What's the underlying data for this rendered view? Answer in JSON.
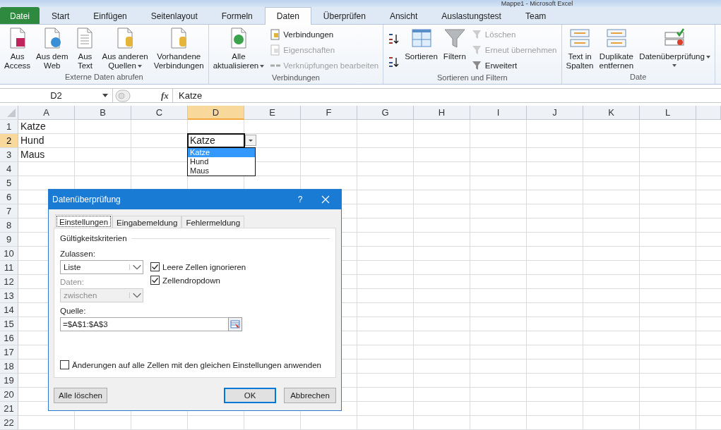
{
  "window": {
    "title": "Mappe1 - Microsoft Excel"
  },
  "tabs": [
    {
      "label": "Datei",
      "selected": false,
      "kind": "file"
    },
    {
      "label": "Start",
      "selected": false,
      "kind": "tab"
    },
    {
      "label": "Einfügen",
      "selected": false,
      "kind": "tab"
    },
    {
      "label": "Seitenlayout",
      "selected": false,
      "kind": "tab"
    },
    {
      "label": "Formeln",
      "selected": false,
      "kind": "tab"
    },
    {
      "label": "Daten",
      "selected": true,
      "kind": "tab"
    },
    {
      "label": "Überprüfen",
      "selected": false,
      "kind": "tab"
    },
    {
      "label": "Ansicht",
      "selected": false,
      "kind": "tab"
    },
    {
      "label": "Auslastungstest",
      "selected": false,
      "kind": "tab"
    },
    {
      "label": "Team",
      "selected": false,
      "kind": "tab"
    }
  ],
  "ribbon": {
    "groups": [
      {
        "label": "Externe Daten abrufen",
        "columns": [
          {
            "kind": "large",
            "items": [
              {
                "lines": [
                  "Aus",
                  "Access"
                ],
                "disabled": false,
                "dropdown": false
              }
            ]
          },
          {
            "kind": "large",
            "items": [
              {
                "lines": [
                  "Aus dem",
                  "Web"
                ],
                "disabled": false,
                "dropdown": false
              }
            ]
          },
          {
            "kind": "large",
            "items": [
              {
                "lines": [
                  "Aus",
                  "Text"
                ],
                "disabled": false,
                "dropdown": false
              }
            ]
          },
          {
            "kind": "large",
            "items": [
              {
                "lines": [
                  "Aus anderen",
                  "Quellen"
                ],
                "disabled": false,
                "dropdown": true
              }
            ]
          },
          {
            "kind": "large",
            "items": [
              {
                "lines": [
                  "Vorhandene",
                  "Verbindungen"
                ],
                "disabled": false,
                "dropdown": false
              }
            ]
          }
        ]
      },
      {
        "label": "Verbindungen",
        "columns": [
          {
            "kind": "large",
            "items": [
              {
                "lines": [
                  "Alle",
                  "aktualisieren"
                ],
                "disabled": false,
                "dropdown": true
              }
            ]
          },
          {
            "kind": "small",
            "items": [
              {
                "lines": [
                  "Verbindungen"
                ],
                "disabled": false,
                "dropdown": false
              },
              {
                "lines": [
                  "Eigenschaften"
                ],
                "disabled": true,
                "dropdown": false
              },
              {
                "lines": [
                  "Verknüpfungen bearbeiten"
                ],
                "disabled": true,
                "dropdown": false
              }
            ]
          }
        ]
      },
      {
        "label": "Sortieren und Filtern",
        "columns": [
          {
            "kind": "icons",
            "items": [
              {
                "kind": "ascending"
              },
              {
                "kind": "descending"
              }
            ]
          },
          {
            "kind": "large",
            "items": [
              {
                "lines": [
                  "Sortieren"
                ],
                "disabled": false,
                "dropdown": false
              }
            ]
          },
          {
            "kind": "large",
            "items": [
              {
                "lines": [
                  "Filtern"
                ],
                "disabled": false,
                "dropdown": false
              }
            ]
          },
          {
            "kind": "small",
            "items": [
              {
                "lines": [
                  "Löschen"
                ],
                "disabled": true,
                "dropdown": false
              },
              {
                "lines": [
                  "Erneut übernehmen"
                ],
                "disabled": true,
                "dropdown": false
              },
              {
                "lines": [
                  "Erweitert"
                ],
                "disabled": false,
                "dropdown": false
              }
            ]
          }
        ]
      },
      {
        "label": "Date",
        "columns": [
          {
            "kind": "large",
            "items": [
              {
                "lines": [
                  "Text in",
                  "Spalten"
                ],
                "disabled": false,
                "dropdown": false
              }
            ]
          },
          {
            "kind": "large",
            "items": [
              {
                "lines": [
                  "Duplikate",
                  "entfernen"
                ],
                "disabled": false,
                "dropdown": false
              }
            ]
          },
          {
            "kind": "large",
            "items": [
              {
                "lines": [
                  "Datenüberprüfung"
                ],
                "disabled": false,
                "dropdown": true
              }
            ]
          }
        ]
      }
    ]
  },
  "formula_bar": {
    "name_box": "D2",
    "function_label": "fx",
    "formula": "Katze"
  },
  "sheet": {
    "columns": [
      {
        "label": "A",
        "selected": false
      },
      {
        "label": "B",
        "selected": false
      },
      {
        "label": "C",
        "selected": false
      },
      {
        "label": "D",
        "selected": true
      },
      {
        "label": "E",
        "selected": false
      },
      {
        "label": "F",
        "selected": false
      },
      {
        "label": "G",
        "selected": false
      },
      {
        "label": "H",
        "selected": false
      },
      {
        "label": "I",
        "selected": false
      },
      {
        "label": "J",
        "selected": false
      },
      {
        "label": "K",
        "selected": false
      },
      {
        "label": "L",
        "selected": false
      }
    ],
    "rows": [
      {
        "number": "1",
        "selected": false,
        "column_a": "Katze"
      },
      {
        "number": "2",
        "selected": true,
        "column_a": "Hund",
        "column_d": "Katze"
      },
      {
        "number": "3",
        "selected": false,
        "column_a": "Maus"
      },
      {
        "number": "4",
        "selected": false
      },
      {
        "number": "5",
        "selected": false
      },
      {
        "number": "6",
        "selected": false
      },
      {
        "number": "7",
        "selected": false
      },
      {
        "number": "8",
        "selected": false
      },
      {
        "number": "9",
        "selected": false
      },
      {
        "number": "10",
        "selected": false
      },
      {
        "number": "11",
        "selected": false
      },
      {
        "number": "12",
        "selected": false
      },
      {
        "number": "13",
        "selected": false
      },
      {
        "number": "14",
        "selected": false
      },
      {
        "number": "15",
        "selected": false
      },
      {
        "number": "16",
        "selected": false
      },
      {
        "number": "17",
        "selected": false
      },
      {
        "number": "18",
        "selected": false
      },
      {
        "number": "19",
        "selected": false
      },
      {
        "number": "20",
        "selected": false
      },
      {
        "number": "21",
        "selected": false
      },
      {
        "number": "22",
        "selected": false
      }
    ],
    "dropdown_list": [
      {
        "label": "Katze",
        "selected": true
      },
      {
        "label": "Hund",
        "selected": false
      },
      {
        "label": "Maus",
        "selected": false
      }
    ]
  },
  "dialog": {
    "title": "Datenüberprüfung",
    "help": "?",
    "tabs": [
      {
        "label": "Einstellungen",
        "selected": true
      },
      {
        "label": "Eingabemeldung",
        "selected": false
      },
      {
        "label": "Fehlermeldung",
        "selected": false
      }
    ],
    "group_label": "Gültigkeitskriterien",
    "allow": {
      "label": "Zulassen:",
      "value": "Liste",
      "disabled": false
    },
    "data": {
      "label": "Daten:",
      "value": "zwischen",
      "disabled": true
    },
    "options": [
      {
        "label": "Leere Zellen ignorieren",
        "checked": true
      },
      {
        "label": "Zellendropdown",
        "checked": true
      }
    ],
    "source": {
      "label": "Quelle:",
      "value": "=$A$1:$A$3"
    },
    "apply_all": {
      "label": "Änderungen auf alle Zellen mit den gleichen Einstellungen anwenden",
      "checked": false
    },
    "buttons": [
      {
        "label": "Alle löschen",
        "kind": "normal"
      },
      {
        "label": "OK",
        "kind": "default"
      },
      {
        "label": "Abbrechen",
        "kind": "normal"
      }
    ]
  }
}
